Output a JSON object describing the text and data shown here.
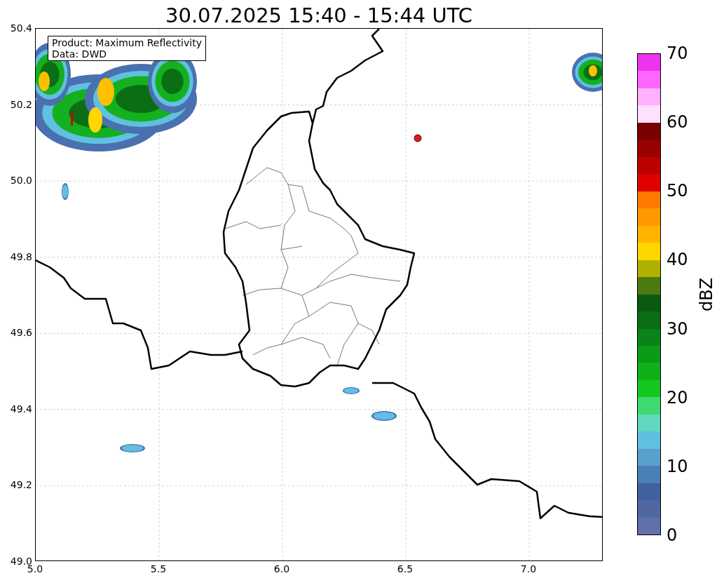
{
  "title": "30.07.2025 15:40 - 15:44 UTC",
  "info_box": [
    "Product: Maximum Reflectivity",
    "Data: DWD"
  ],
  "x_axis": {
    "ticks": [
      "5.0",
      "5.5",
      "6.0",
      "6.5",
      "7.0"
    ]
  },
  "y_axis": {
    "ticks": [
      "50.4",
      "50.2",
      "50.0",
      "49.8",
      "49.6",
      "49.4",
      "49.2",
      "49.0"
    ]
  },
  "colorbar": {
    "label": "dBZ",
    "ticks": [
      "70",
      "60",
      "50",
      "40",
      "30",
      "20",
      "10",
      "0"
    ],
    "bands": [
      {
        "color": "#ee33ee"
      },
      {
        "color": "#ff66ff"
      },
      {
        "color": "#ffb0ff"
      },
      {
        "color": "#ffe0ff"
      },
      {
        "color": "#780000"
      },
      {
        "color": "#990000"
      },
      {
        "color": "#bb0000"
      },
      {
        "color": "#e00000"
      },
      {
        "color": "#ff7a00"
      },
      {
        "color": "#ff9900"
      },
      {
        "color": "#ffb300"
      },
      {
        "color": "#ffd700"
      },
      {
        "color": "#b0b000"
      },
      {
        "color": "#4a7a10"
      },
      {
        "color": "#0a5a10"
      },
      {
        "color": "#0a6e14"
      },
      {
        "color": "#0a8418"
      },
      {
        "color": "#0c9a18"
      },
      {
        "color": "#10b018"
      },
      {
        "color": "#14c820"
      },
      {
        "color": "#40d870"
      },
      {
        "color": "#60d8c0"
      },
      {
        "color": "#60c0e0"
      },
      {
        "color": "#5aa0cc"
      },
      {
        "color": "#4a80b8"
      },
      {
        "color": "#4060a0"
      },
      {
        "color": "#5068a0"
      },
      {
        "color": "#6070a8"
      }
    ]
  }
}
